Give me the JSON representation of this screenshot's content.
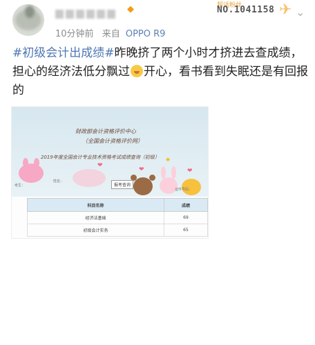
{
  "post": {
    "time": "10分钟前",
    "source_prefix": "来自",
    "device": "OPPO R9",
    "card_label": "超话粉丝",
    "card_number": "NO.1041158",
    "menu_glyph": "⌄",
    "topic": "#初级会计出成绩#",
    "text_part1": "昨晚挤了两个小时才挤进去查成绩，担心的经济法低分飘过",
    "text_part2": "开心，看书看到失眠还是有回报的"
  },
  "photo": {
    "line1": "财政部会计资格评价中心",
    "line2": "（全国会计资格评价网）",
    "line3": "2019年度全国会计专业技术资格考试成绩查询（初级）",
    "link": "报考查询",
    "left_note": "考生：",
    "mid_note": "姓名：",
    "right_note": "证件号码：",
    "table": {
      "headers": [
        "科目名称",
        "成绩"
      ],
      "rows": [
        [
          "经济法基础",
          "69"
        ],
        [
          "初级会计实务",
          "65"
        ]
      ]
    }
  },
  "colors": {
    "topic": "#4e77b3",
    "device": "#5b7fb5",
    "card_accent": "#e7a43b"
  }
}
